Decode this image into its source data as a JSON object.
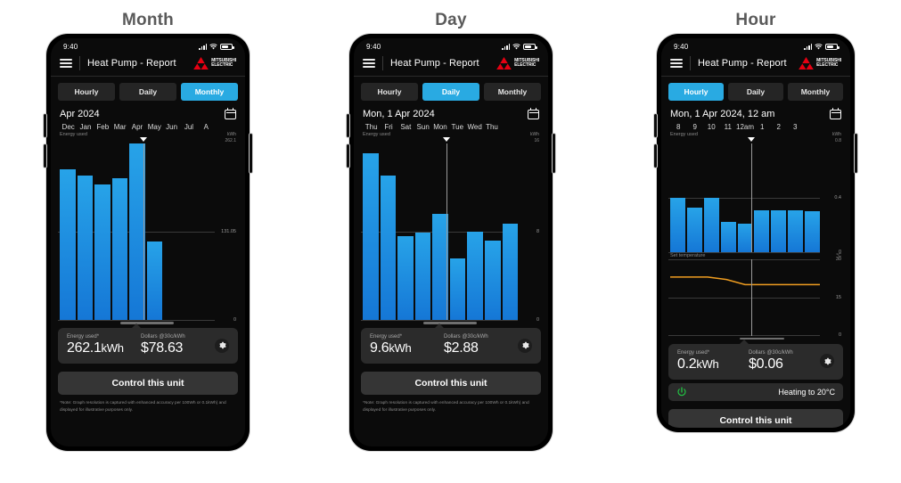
{
  "panels": [
    {
      "title": "Month",
      "status": {
        "time": "9:40"
      },
      "appbar": {
        "title": "Heat Pump - Report",
        "logo_line1": "MITSUBISHI",
        "logo_line2": "ELECTRIC"
      },
      "segments": [
        {
          "label": "Hourly",
          "active": false
        },
        {
          "label": "Daily",
          "active": false
        },
        {
          "label": "Monthly",
          "active": true
        }
      ],
      "date_label": "Apr 2024",
      "energy_label": "Energy used",
      "unit_label": "kWh",
      "summary": {
        "energy_caption": "Energy used*",
        "energy_value": "262.1",
        "energy_unit": "kWh",
        "dollars_caption": "Dollars @30c/kWh",
        "dollars_value": "$78.63"
      },
      "control_label": "Control this unit",
      "footnote": "*Note: Graph resolution is captured with enhanced accuracy per 100Wh or 0.1kWh) and displayed for illustrative purposes only.",
      "has_status_row": false,
      "has_footnote": true,
      "chart_data": {
        "type": "bar",
        "title": "Energy used",
        "ylabel": "kWh",
        "categories": [
          "Dec",
          "Jan",
          "Feb",
          "Mar",
          "Apr",
          "May",
          "Jun",
          "Jul",
          "A"
        ],
        "values": [
          224.0,
          214.0,
          201.0,
          211.0,
          262.1,
          116.0,
          null,
          null,
          null
        ],
        "ylim": [
          0,
          262.1
        ],
        "yticks": [
          "262.1",
          "131.05",
          "0"
        ],
        "ytick_values": [
          262.1,
          131.05,
          0
        ],
        "grid": true,
        "selected_index": 4,
        "selected_label": "Apr"
      }
    },
    {
      "title": "Day",
      "status": {
        "time": "9:40"
      },
      "appbar": {
        "title": "Heat Pump - Report",
        "logo_line1": "MITSUBISHI",
        "logo_line2": "ELECTRIC"
      },
      "segments": [
        {
          "label": "Hourly",
          "active": false
        },
        {
          "label": "Daily",
          "active": true
        },
        {
          "label": "Monthly",
          "active": false
        }
      ],
      "date_label": "Mon, 1 Apr 2024",
      "energy_label": "Energy used",
      "unit_label": "kWh",
      "summary": {
        "energy_caption": "Energy used*",
        "energy_value": "9.6",
        "energy_unit": "kWh",
        "dollars_caption": "Dollars @30c/kWh",
        "dollars_value": "$2.88"
      },
      "control_label": "Control this unit",
      "footnote": "*Note: Graph resolution is captured with enhanced accuracy per 100Wh or 0.1kWh) and displayed for illustrative purposes only.",
      "has_status_row": false,
      "has_footnote": true,
      "chart_data": {
        "type": "bar",
        "title": "Energy used",
        "ylabel": "kWh",
        "categories": [
          "Thu",
          "Fri",
          "Sat",
          "Sun",
          "Mon",
          "Tue",
          "Wed",
          "Thu",
          ""
        ],
        "values": [
          15.1,
          13.1,
          7.6,
          7.9,
          9.6,
          5.6,
          8.0,
          7.2,
          8.7
        ],
        "ylim": [
          0,
          16
        ],
        "yticks": [
          "16",
          "8",
          "0"
        ],
        "ytick_values": [
          16,
          8,
          0
        ],
        "grid": true,
        "selected_index": 4,
        "selected_label": "Mon"
      }
    },
    {
      "title": "Hour",
      "status": {
        "time": "9:40"
      },
      "appbar": {
        "title": "Heat Pump - Report",
        "logo_line1": "MITSUBISHI",
        "logo_line2": "ELECTRIC"
      },
      "segments": [
        {
          "label": "Hourly",
          "active": true
        },
        {
          "label": "Daily",
          "active": false
        },
        {
          "label": "Monthly",
          "active": false
        }
      ],
      "date_label": "Mon, 1 Apr 2024, 12 am",
      "energy_label": "Energy used",
      "unit_label": "kWh",
      "temp_label": "Set temperature",
      "temp_unit_label": "°C",
      "summary": {
        "energy_caption": "Energy used*",
        "energy_value": "0.2",
        "energy_unit": "kWh",
        "dollars_caption": "Dollars @30c/kWh",
        "dollars_value": "$0.06"
      },
      "status_row": {
        "text": "Heating to 20°C",
        "power_color": "#22c544"
      },
      "control_label": "Control this unit",
      "has_status_row": true,
      "has_footnote": false,
      "chart_data": {
        "type": "bar",
        "title": "Energy used",
        "ylabel": "kWh",
        "categories": [
          "8",
          "9",
          "10",
          "11",
          "12am",
          "1",
          "2",
          "3",
          ""
        ],
        "values": [
          0.4,
          0.33,
          0.4,
          0.22,
          0.21,
          0.31,
          0.31,
          0.31,
          0.3
        ],
        "ylim": [
          0,
          0.8
        ],
        "yticks": [
          "0.8",
          "0.4",
          "0"
        ],
        "ytick_values": [
          0.8,
          0.4,
          0
        ],
        "grid": true,
        "selected_index": 4,
        "selected_label": "12am",
        "secondary": {
          "type": "line",
          "title": "Set temperature",
          "ylabel": "°C",
          "color": "#ef9d20",
          "ylim": [
            0,
            30
          ],
          "yticks": [
            "30",
            "15",
            "0"
          ],
          "ytick_values": [
            30,
            15,
            0
          ],
          "values": [
            23,
            23,
            23,
            22,
            20,
            20,
            20,
            20,
            20
          ]
        }
      }
    }
  ],
  "colors": {
    "accent": "#29aae2",
    "bar_top": "#27a3e8",
    "bar_bottom": "#1577d6",
    "temp_line": "#ef9d20",
    "power_green": "#22c544",
    "logo_red": "#e60012"
  }
}
